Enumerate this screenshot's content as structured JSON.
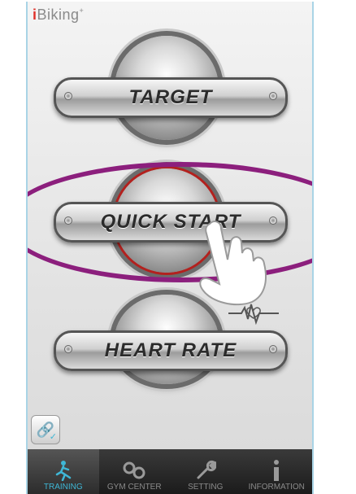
{
  "app": {
    "logo_i": "i",
    "logo_text": "Biking",
    "logo_mark": "+"
  },
  "buttons": {
    "target": {
      "label": "Target"
    },
    "quick_start": {
      "label": "Quick Start"
    },
    "heart_rate": {
      "label": "Heart Rate"
    }
  },
  "tabs": [
    {
      "label": "TRAINING",
      "icon": "runner-icon",
      "active": true
    },
    {
      "label": "GYM CENTER",
      "icon": "gym-icon",
      "active": false
    },
    {
      "label": "SETTING",
      "icon": "wrench-icon",
      "active": false
    },
    {
      "label": "INFORMATION",
      "icon": "info-icon",
      "active": false
    }
  ],
  "colors": {
    "highlight_oval": "#8c1f7d",
    "accent": "#3fb7d6",
    "start_ring": "#b3211e"
  }
}
